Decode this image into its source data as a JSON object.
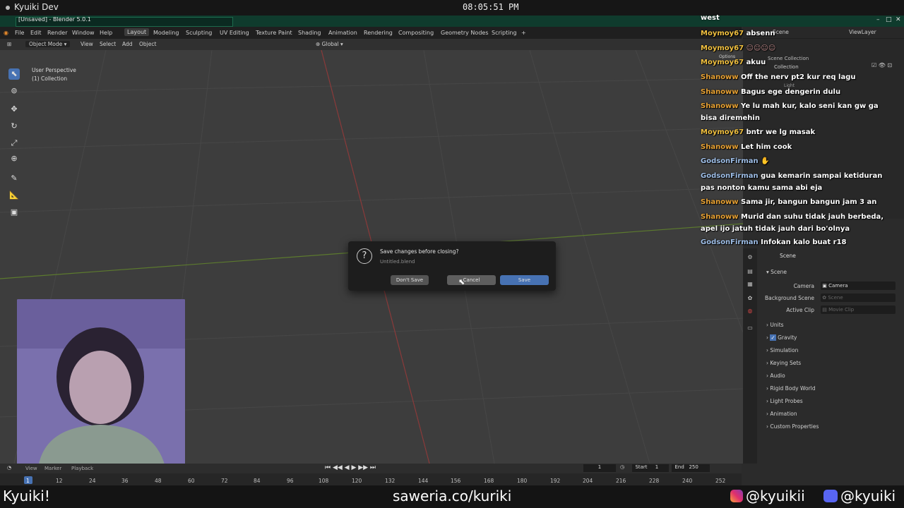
{
  "os": {
    "title": "Kyuiki Dev",
    "clock": "08:05:51 PM"
  },
  "window": {
    "title": "[Unsaved] - Blender 5.0.1",
    "controls": [
      "–",
      "□",
      "✕"
    ]
  },
  "menu": {
    "items": [
      "File",
      "Edit",
      "Render",
      "Window",
      "Help"
    ],
    "workspaces": [
      "Layout",
      "Modeling",
      "Sculpting",
      "UV Editing",
      "Texture Paint",
      "Shading",
      "Animation",
      "Rendering",
      "Compositing",
      "Geometry Nodes",
      "Scripting"
    ],
    "add_tab": "+"
  },
  "viewport_header": {
    "mode": "Object Mode",
    "items": [
      "View",
      "Select",
      "Add",
      "Object"
    ],
    "transform": "Global"
  },
  "viewport": {
    "perspective": "User Perspective",
    "collection": "(1) Collection"
  },
  "dialog": {
    "title": "Save changes before closing?",
    "file": "Untitled.blend",
    "dont_save": "Don't Save",
    "cancel": "Cancel",
    "save": "Save"
  },
  "outliner": {
    "search": "Scene",
    "view_layer": "ViewLayer",
    "items": [
      "Scene Collection",
      "Collection",
      "Light"
    ],
    "options": "Options"
  },
  "properties": {
    "scene_label": "Scene",
    "section": "Scene",
    "fields": [
      {
        "label": "Camera",
        "value": "Camera"
      },
      {
        "label": "Background Scene",
        "value": "Scene"
      },
      {
        "label": "Active Clip",
        "value": "Movie Clip"
      }
    ],
    "panels": [
      "Units",
      "Gravity",
      "Simulation",
      "Keying Sets",
      "Audio",
      "Rigid Body World",
      "Light Probes",
      "Animation",
      "Custom Properties"
    ]
  },
  "chat": {
    "header": "west",
    "messages": [
      {
        "user": "Moymoy67",
        "text": "absenn"
      },
      {
        "user": "Moymoy67",
        "text": ""
      },
      {
        "user": "Moymoy67",
        "text": "akuu"
      },
      {
        "user": "Shanoww",
        "text": "Off the nerv pt2 kur req lagu"
      },
      {
        "user": "Shanoww",
        "text": "Bagus ege dengerin dulu"
      },
      {
        "user": "Shanoww",
        "text": "Ye lu mah kur, kalo seni kan gw ga bisa diremehin"
      },
      {
        "user": "Moymoy67",
        "text": "bntr we lg masak"
      },
      {
        "user": "Shanoww",
        "text": "Let him cook"
      },
      {
        "user": "GodsonFirman",
        "text": ""
      },
      {
        "user": "GodsonFirman",
        "text": "gua kemarin sampai ketiduran pas nonton kamu sama abi eja"
      },
      {
        "user": "Shanoww",
        "text": "Sama jir, bangun bangun jam 3 an"
      },
      {
        "user": "Shanoww",
        "text": "Murid dan suhu tidak jauh berbeda, apel ijo jatuh tidak jauh dari bo'olnya"
      },
      {
        "user": "GodsonFirman",
        "text": "Infokan kalo buat r18"
      }
    ]
  },
  "timeline": {
    "menu": [
      "View",
      "Marker",
      "Playback"
    ],
    "current_frame": "1",
    "start_label": "Start",
    "start": "1",
    "end_label": "End",
    "end": "250",
    "ticks": [
      "1",
      "12",
      "24",
      "36",
      "48",
      "60",
      "72",
      "84",
      "96",
      "108",
      "120",
      "132",
      "144",
      "156",
      "168",
      "180",
      "192",
      "204",
      "216",
      "228",
      "240",
      "252"
    ]
  },
  "overlay": {
    "left": "Kyuiki!",
    "center": "saweria.co/kuriki",
    "instagram": "@kyuikii",
    "discord": "@kyuiki"
  }
}
